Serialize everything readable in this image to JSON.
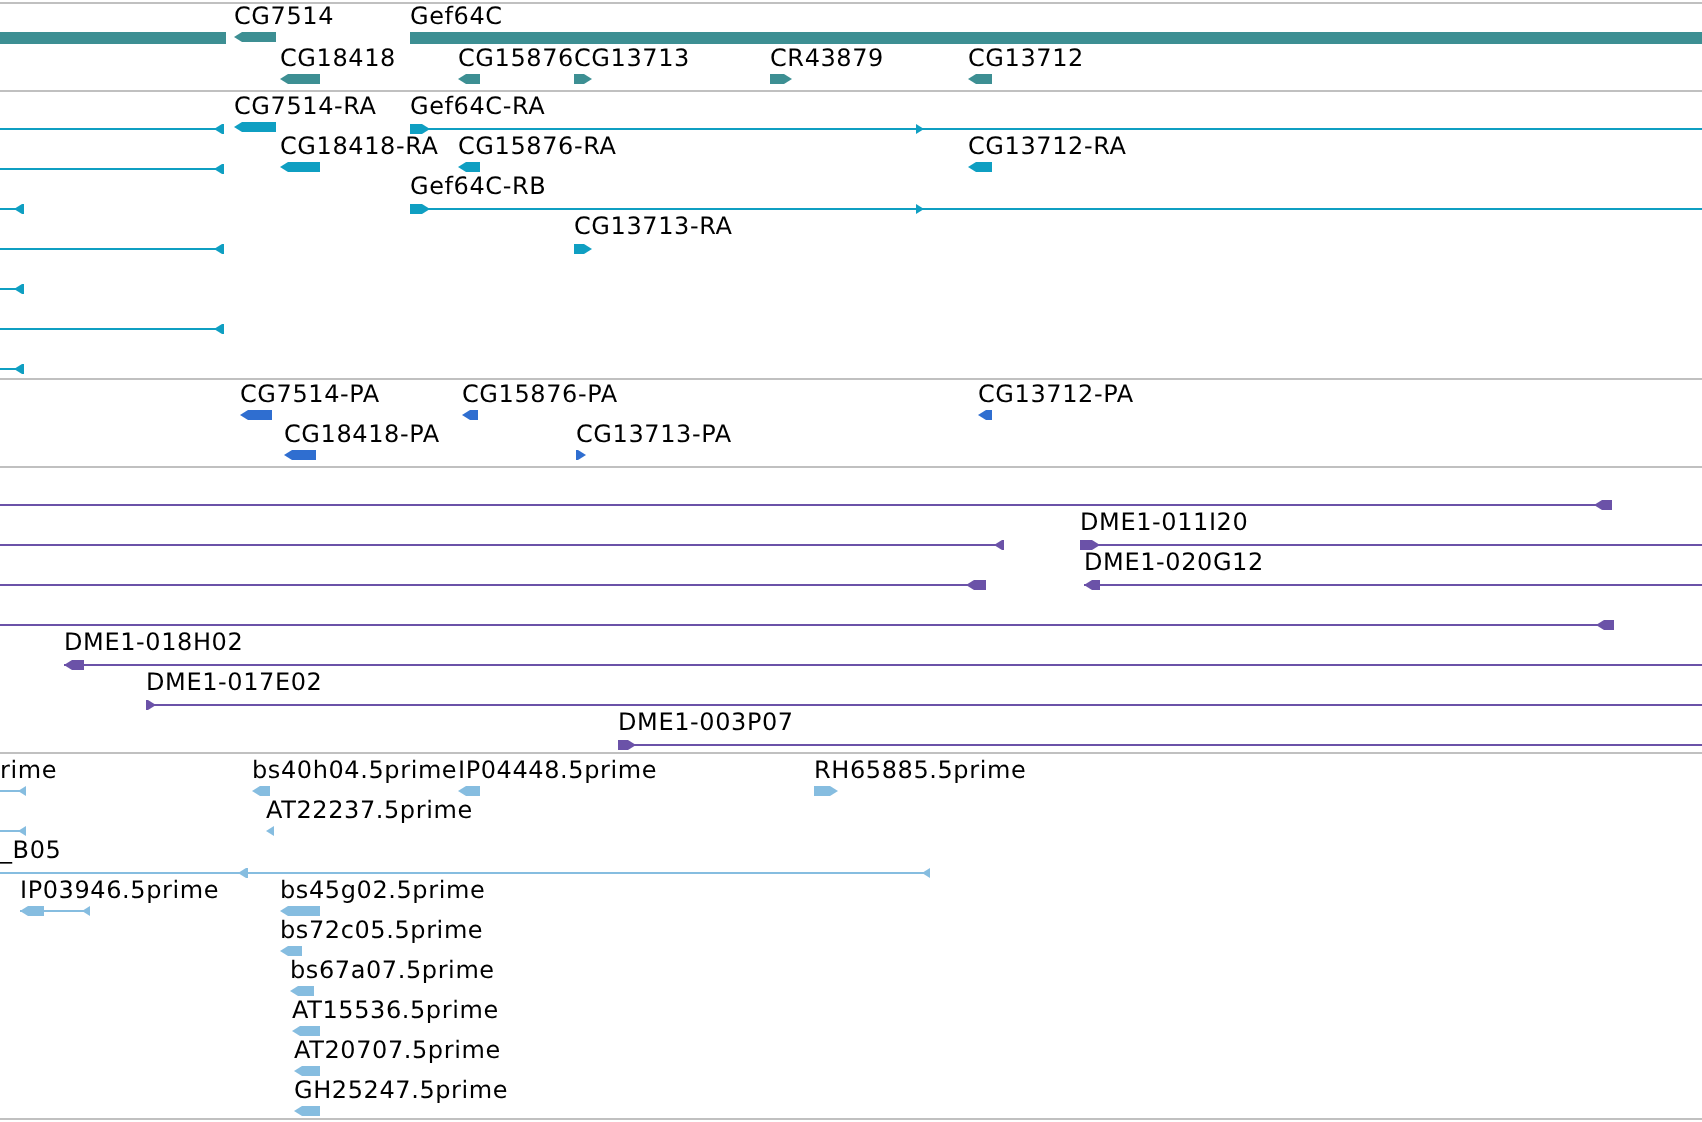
{
  "tracks": [
    {
      "color": "#3d8f93",
      "features": [
        {
          "kind": "span"
        },
        {
          "kind": "arrow",
          "label": "CG7514",
          "reverse": true
        },
        {
          "kind": "span",
          "label": "Gef64C"
        },
        {
          "kind": "arrow",
          "label": "CG18418",
          "reverse": true
        },
        {
          "kind": "arrow",
          "label": "CG15876",
          "reverse": true
        },
        {
          "kind": "arrow",
          "label": "CG13713",
          "reverse": false
        },
        {
          "kind": "arrow",
          "label": "CR43879",
          "reverse": false
        },
        {
          "kind": "arrow",
          "label": "CG13712",
          "reverse": true
        }
      ]
    },
    {
      "color": "#0f9fc2",
      "features": [
        {
          "kind": "arrow",
          "reverse": true
        },
        {
          "kind": "arrow",
          "label": "CG7514-RA",
          "reverse": true
        },
        {
          "kind": "arrow",
          "label": "Gef64C-RA",
          "reverse": false
        },
        {
          "kind": "arrow",
          "reverse": true
        },
        {
          "kind": "arrow",
          "label": "CG18418-RA",
          "reverse": true
        },
        {
          "kind": "arrow",
          "label": "CG15876-RA",
          "reverse": true
        },
        {
          "kind": "arrow",
          "label": "CG13712-RA",
          "reverse": true
        },
        {
          "kind": "arrow",
          "reverse": true
        },
        {
          "kind": "arrow",
          "label": "Gef64C-RB",
          "reverse": false
        },
        {
          "kind": "arrow",
          "reverse": true
        },
        {
          "kind": "arrow",
          "label": "CG13713-RA",
          "reverse": false
        },
        {
          "kind": "arrow",
          "reverse": true
        },
        {
          "kind": "arrow",
          "reverse": true
        },
        {
          "kind": "arrow",
          "reverse": true
        }
      ]
    },
    {
      "color": "#2f6ed0",
      "features": [
        {
          "kind": "arrow",
          "label": "CG7514-PA",
          "reverse": true
        },
        {
          "kind": "arrow",
          "label": "CG15876-PA",
          "reverse": true
        },
        {
          "kind": "arrow",
          "label": "CG13712-PA",
          "reverse": true
        },
        {
          "kind": "arrow",
          "label": "CG18418-PA",
          "reverse": true
        },
        {
          "kind": "arrow",
          "label": "CG13713-PA",
          "reverse": false
        }
      ]
    },
    {
      "color": "#6b52a8",
      "features": [
        {
          "kind": "arrow",
          "reverse": true
        },
        {
          "kind": "arrow",
          "reverse": true
        },
        {
          "kind": "arrow",
          "label": "DME1-011I20",
          "reverse": false
        },
        {
          "kind": "arrow",
          "reverse": true
        },
        {
          "kind": "arrow",
          "label": "DME1-020G12",
          "reverse": true
        },
        {
          "kind": "arrow",
          "reverse": true
        },
        {
          "kind": "arrow",
          "label": "DME1-018H02",
          "reverse": true
        },
        {
          "kind": "arrow",
          "label": "DME1-017E02",
          "reverse": false
        },
        {
          "kind": "arrow",
          "label": "DME1-003P07",
          "reverse": false
        }
      ]
    },
    {
      "color": "#86bde0",
      "features": [
        {
          "kind": "arrow",
          "label": "rime",
          "reverse": true
        },
        {
          "kind": "arrow",
          "label": "bs40h04.5prime",
          "reverse": true
        },
        {
          "kind": "arrow",
          "label": "IP04448.5prime",
          "reverse": true
        },
        {
          "kind": "arrow",
          "label": "RH65885.5prime",
          "reverse": false
        },
        {
          "kind": "arrow",
          "reverse": true
        },
        {
          "kind": "arrow",
          "label": "AT22237.5prime",
          "reverse": true
        },
        {
          "kind": "arrow",
          "label": "_B05",
          "reverse": true
        },
        {
          "kind": "arrow",
          "label": "IP03946.5prime",
          "reverse": true
        },
        {
          "kind": "arrow",
          "label": "bs45g02.5prime",
          "reverse": true
        },
        {
          "kind": "arrow",
          "label": "bs72c05.5prime",
          "reverse": true
        },
        {
          "kind": "arrow",
          "label": "bs67a07.5prime",
          "reverse": true
        },
        {
          "kind": "arrow",
          "label": "AT15536.5prime",
          "reverse": true
        },
        {
          "kind": "arrow",
          "label": "AT20707.5prime",
          "reverse": true
        },
        {
          "kind": "arrow",
          "label": "GH25247.5prime",
          "reverse": true
        }
      ]
    }
  ]
}
